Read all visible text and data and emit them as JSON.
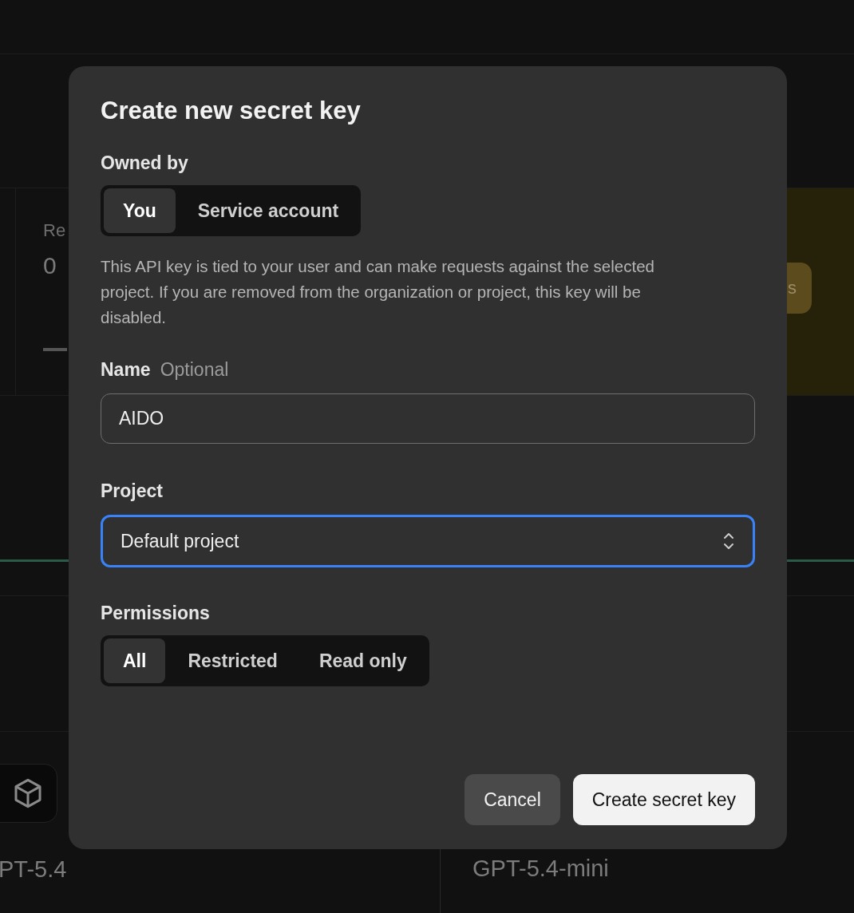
{
  "background": {
    "stat_card": {
      "label": "Re",
      "value": "0"
    },
    "promo_button": "s",
    "models": [
      {
        "name": "PT-5.4"
      },
      {
        "name": "GPT-5.4-mini"
      }
    ]
  },
  "dialog": {
    "title": "Create new secret key",
    "owned_by": {
      "label": "Owned by",
      "options": [
        {
          "label": "You",
          "selected": true
        },
        {
          "label": "Service account",
          "selected": false
        }
      ]
    },
    "description": "This API key is tied to your user and can make requests against the selected project. If you are removed from the organization or project, this key will be disabled.",
    "name_field": {
      "label": "Name",
      "hint": "Optional",
      "value": "AIDO"
    },
    "project_field": {
      "label": "Project",
      "value": "Default project",
      "focused": true
    },
    "permissions": {
      "label": "Permissions",
      "options": [
        {
          "label": "All",
          "selected": true
        },
        {
          "label": "Restricted",
          "selected": false
        },
        {
          "label": "Read only",
          "selected": false
        }
      ]
    },
    "buttons": [
      {
        "label": "Cancel",
        "kind": "secondary"
      },
      {
        "label": "Create secret key",
        "kind": "primary"
      }
    ]
  }
}
